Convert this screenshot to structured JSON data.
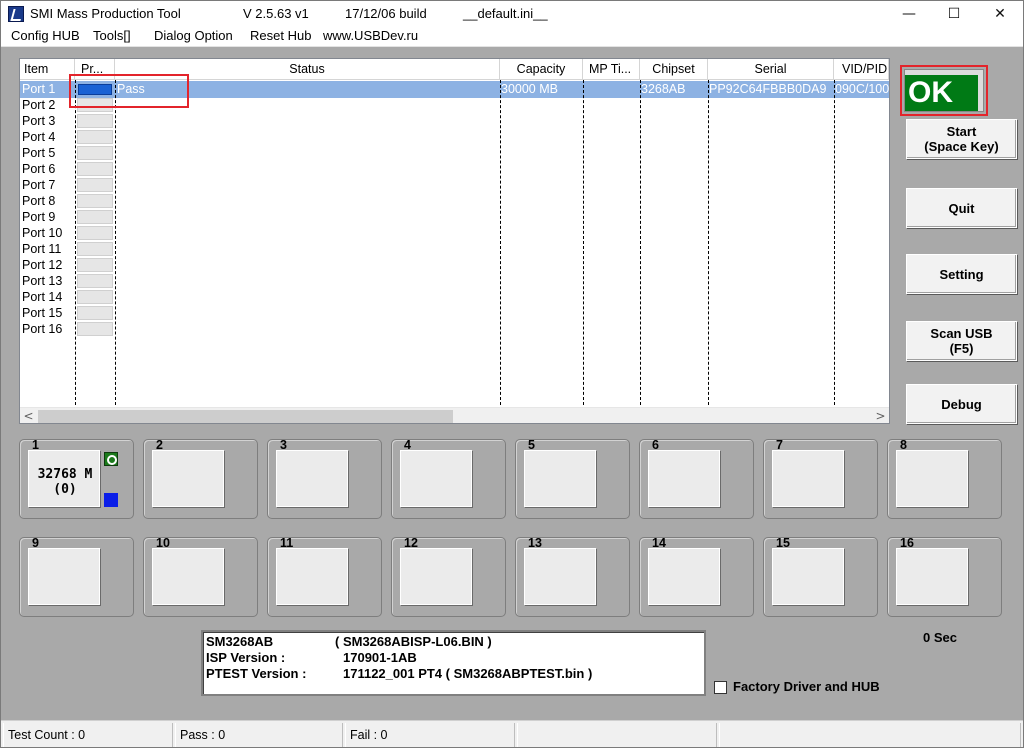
{
  "window": {
    "title": "SMI Mass Production Tool",
    "version": "V 2.5.63   v1",
    "build": "17/12/06 build",
    "ini_file": "__default.ini__",
    "minimize": "—",
    "maximize": "☐",
    "close": "✕"
  },
  "menu": {
    "items": [
      "Config HUB",
      "Tools[]",
      "Dialog Option",
      "Reset Hub",
      "www.USBDev.ru"
    ]
  },
  "table": {
    "columns": [
      "Item",
      "Pr...",
      "Status",
      "Capacity",
      "MP Ti...",
      "Chipset",
      "Serial",
      "VID/PID"
    ],
    "selected_row": {
      "port": "Port 1",
      "status": "Pass",
      "capacity": "30000 MB",
      "chipset": "3268AB",
      "serial": "PP92C64FBBB0DA9",
      "vidpid": "090C/100"
    },
    "ports": [
      "Port 1",
      "Port 2",
      "Port 3",
      "Port 4",
      "Port 5",
      "Port 6",
      "Port 7",
      "Port 8",
      "Port 9",
      "Port 10",
      "Port 11",
      "Port 12",
      "Port 13",
      "Port 14",
      "Port 15",
      "Port 16"
    ],
    "scroll_left": "<",
    "scroll_right": ">"
  },
  "side": {
    "ok": "OK",
    "start": "Start\n(Space Key)",
    "quit": "Quit",
    "setting": "Setting",
    "scan": "Scan USB\n(F5)",
    "debug": "Debug"
  },
  "port_panels": {
    "numbers": [
      "1",
      "2",
      "3",
      "4",
      "5",
      "6",
      "7",
      "8",
      "9",
      "10",
      "11",
      "12",
      "13",
      "14",
      "15",
      "16"
    ],
    "port1_line1": "32768 M",
    "port1_line2": "(0)"
  },
  "info": {
    "chip": "SM3268AB",
    "chip_file": "( SM3268ABISP-L06.BIN )",
    "isp_label": "ISP Version :",
    "isp_value": "170901-1AB",
    "ptest_label": "PTEST Version :",
    "ptest_value": "171122_001   PT4 ( SM3268ABPTEST.bin )"
  },
  "timer": "0 Sec",
  "factory_label": "Factory Driver and HUB",
  "status": {
    "test_count": "Test Count : 0",
    "pass": "Pass : 0",
    "fail": "Fail : 0"
  }
}
